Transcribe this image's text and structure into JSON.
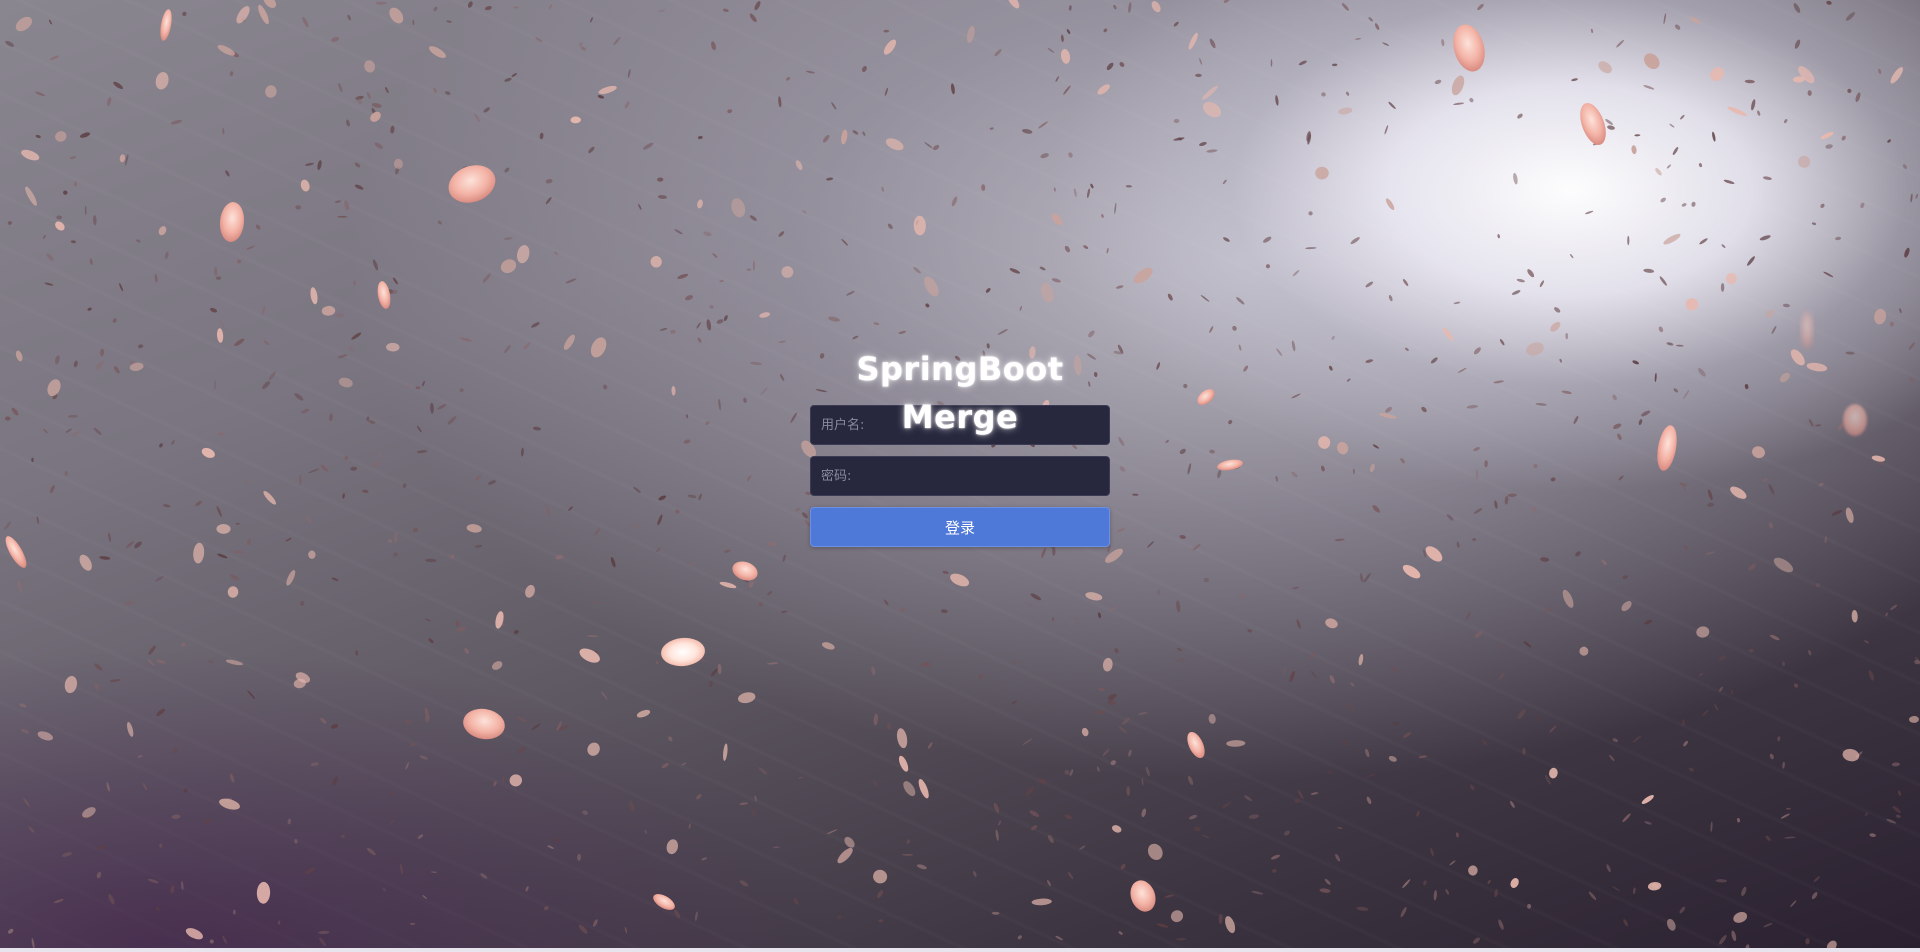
{
  "login": {
    "title": "SpringBoot Merge",
    "username_placeholder": "用户名:",
    "password_placeholder": "密码:",
    "submit_label": "登录"
  },
  "colors": {
    "button": "#4f79d9",
    "input_background": "#27273d",
    "petal": "#f3b3a6"
  }
}
